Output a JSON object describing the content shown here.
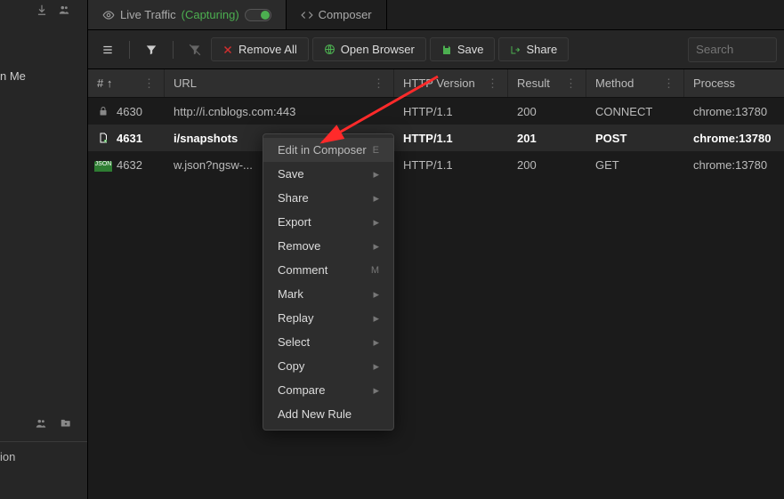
{
  "left_rail": {
    "me_label": "n Me",
    "ion_label": "ion"
  },
  "tabs": {
    "live_traffic": {
      "label": "Live Traffic",
      "capturing": "(Capturing)"
    },
    "composer": {
      "label": "Composer"
    }
  },
  "toolbar": {
    "remove_all": "Remove All",
    "open_browser": "Open Browser",
    "save": "Save",
    "share": "Share",
    "search_placeholder": "Search"
  },
  "columns": {
    "idx": "# ↑",
    "url": "URL",
    "http": "HTTP Version",
    "result": "Result",
    "method": "Method",
    "process": "Process"
  },
  "rows": [
    {
      "idx": "4630",
      "url": "http://i.cnblogs.com:443",
      "http": "HTTP/1.1",
      "result": "200",
      "method": "CONNECT",
      "process": "chrome:13780",
      "icon": "lock",
      "selected": false
    },
    {
      "idx": "4631",
      "url": "i/snapshots",
      "http": "HTTP/1.1",
      "result": "201",
      "method": "POST",
      "process": "chrome:13780",
      "icon": "doc-new",
      "selected": true
    },
    {
      "idx": "4632",
      "url": "w.json?ngsw-...",
      "http": "HTTP/1.1",
      "result": "200",
      "method": "GET",
      "process": "chrome:13780",
      "icon": "json",
      "selected": false
    }
  ],
  "context_menu": {
    "items": [
      {
        "label": "Edit in Composer",
        "kbd": "E",
        "hover": true
      },
      {
        "label": "Save",
        "sub": true
      },
      {
        "label": "Share",
        "sub": true
      },
      {
        "label": "Export",
        "sub": true
      },
      {
        "label": "Remove",
        "sub": true
      },
      {
        "label": "Comment",
        "kbd": "M"
      },
      {
        "label": "Mark",
        "sub": true
      },
      {
        "label": "Replay",
        "sub": true
      },
      {
        "label": "Select",
        "sub": true
      },
      {
        "label": "Copy",
        "sub": true
      },
      {
        "label": "Compare",
        "sub": true
      },
      {
        "label": "Add New Rule"
      }
    ]
  },
  "colors": {
    "accent_green": "#4caf50",
    "accent_red": "#d32f2f",
    "bg": "#1b1b1b"
  }
}
